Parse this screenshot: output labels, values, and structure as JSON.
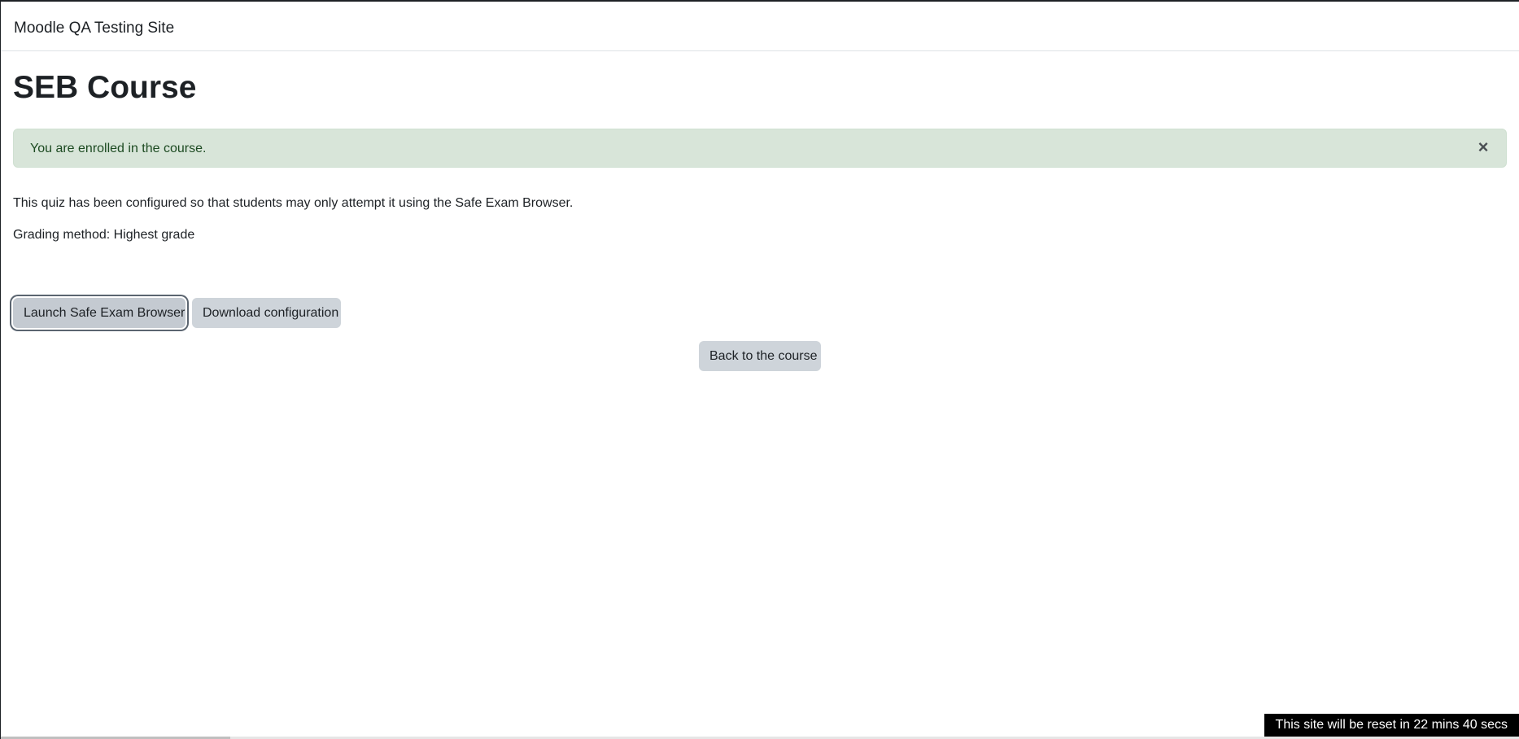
{
  "header": {
    "site_name": "Moodle QA Testing Site"
  },
  "main": {
    "title": "SEB Course",
    "alert": {
      "message": "You are enrolled in the course.",
      "close_symbol": "×",
      "background_color": "#d8e5d9",
      "text_color": "#1c4a21"
    },
    "info_lines": [
      "This quiz has been configured so that students may only attempt it using the Safe Exam Browser.",
      "Grading method: Highest grade"
    ],
    "buttons": {
      "launch_label": "Launch Safe Exam Browser",
      "download_label": "Download configuration",
      "back_label": "Back to the course"
    }
  },
  "footer": {
    "reset_notice": "This site will be reset in 22 mins 40 secs"
  },
  "colors": {
    "button_background": "#ced4da",
    "text": "#1d2125",
    "banner_background": "#000000"
  },
  "icons": {
    "alert_close": "close-icon"
  }
}
